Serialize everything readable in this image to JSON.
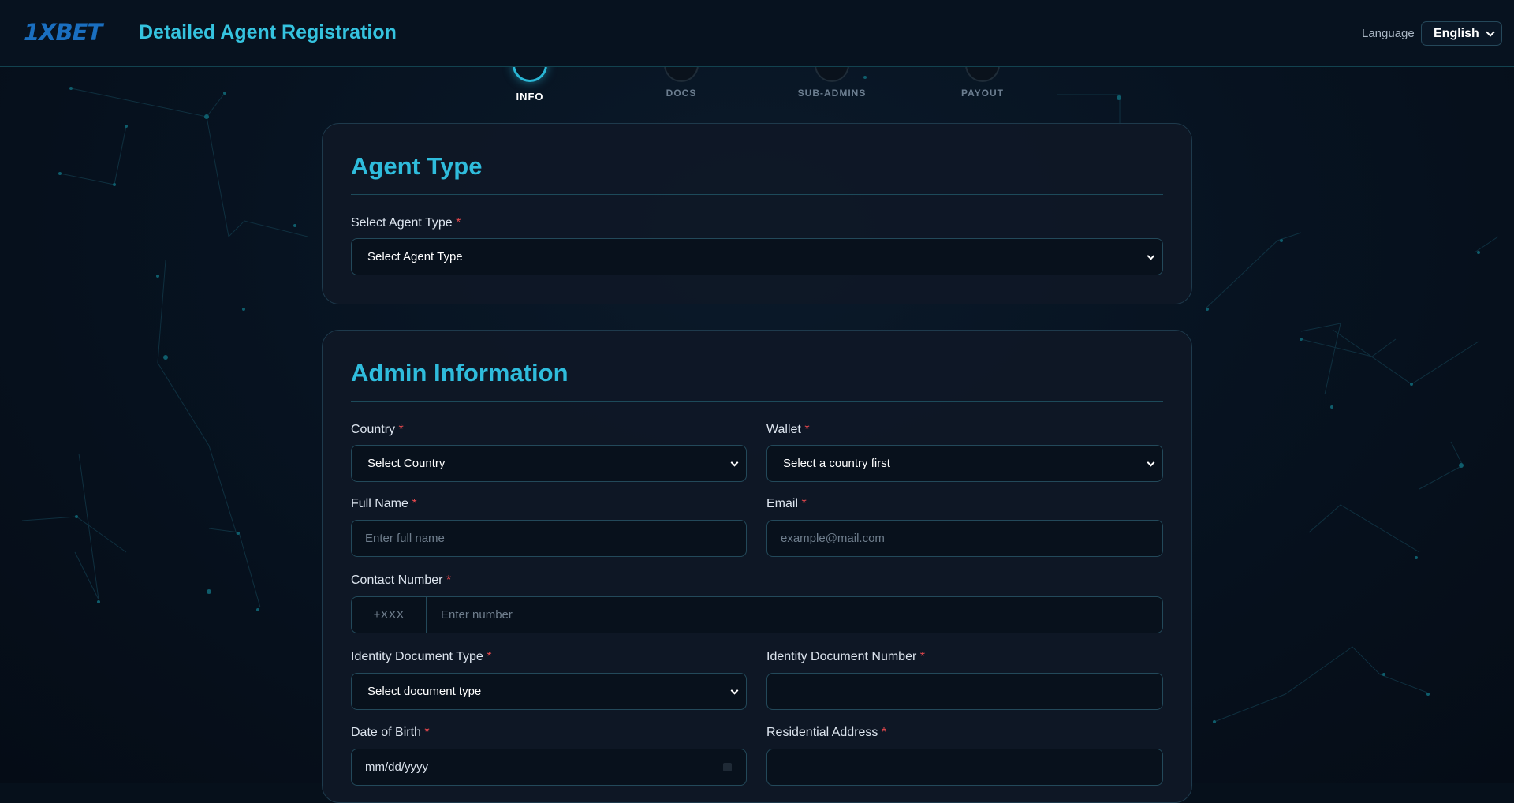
{
  "header": {
    "logo": "1XBET",
    "title": "Detailed Agent Registration",
    "language_label": "Language",
    "language_value": "English"
  },
  "stepper": [
    {
      "label": "INFO",
      "active": true
    },
    {
      "label": "DOCS",
      "active": false
    },
    {
      "label": "SUB-ADMINS",
      "active": false
    },
    {
      "label": "PAYOUT",
      "active": false
    }
  ],
  "agent_type_section": {
    "title": "Agent Type",
    "select_label": "Select Agent Type",
    "required_mark": "*",
    "select_value": "Select Agent Type"
  },
  "admin_section": {
    "title": "Admin Information",
    "country": {
      "label": "Country",
      "value": "Select Country"
    },
    "wallet": {
      "label": "Wallet",
      "value": "Select a country first"
    },
    "full_name": {
      "label": "Full Name",
      "placeholder": "Enter full name"
    },
    "email": {
      "label": "Email",
      "placeholder": "example@mail.com"
    },
    "contact": {
      "label": "Contact Number",
      "prefix": "+XXX",
      "placeholder": "Enter number"
    },
    "id_doc_type": {
      "label": "Identity Document Type",
      "value": "Select document type"
    },
    "id_doc_number": {
      "label": "Identity Document Number",
      "placeholder": ""
    },
    "dob": {
      "label": "Date of Birth",
      "value": "mm/dd/yyyy"
    },
    "address": {
      "label": "Residential Address",
      "placeholder": ""
    }
  },
  "colors": {
    "accent": "#2fbcdc",
    "required": "#e5484d",
    "background": "#06101b",
    "logo": "#1a6fc0"
  }
}
